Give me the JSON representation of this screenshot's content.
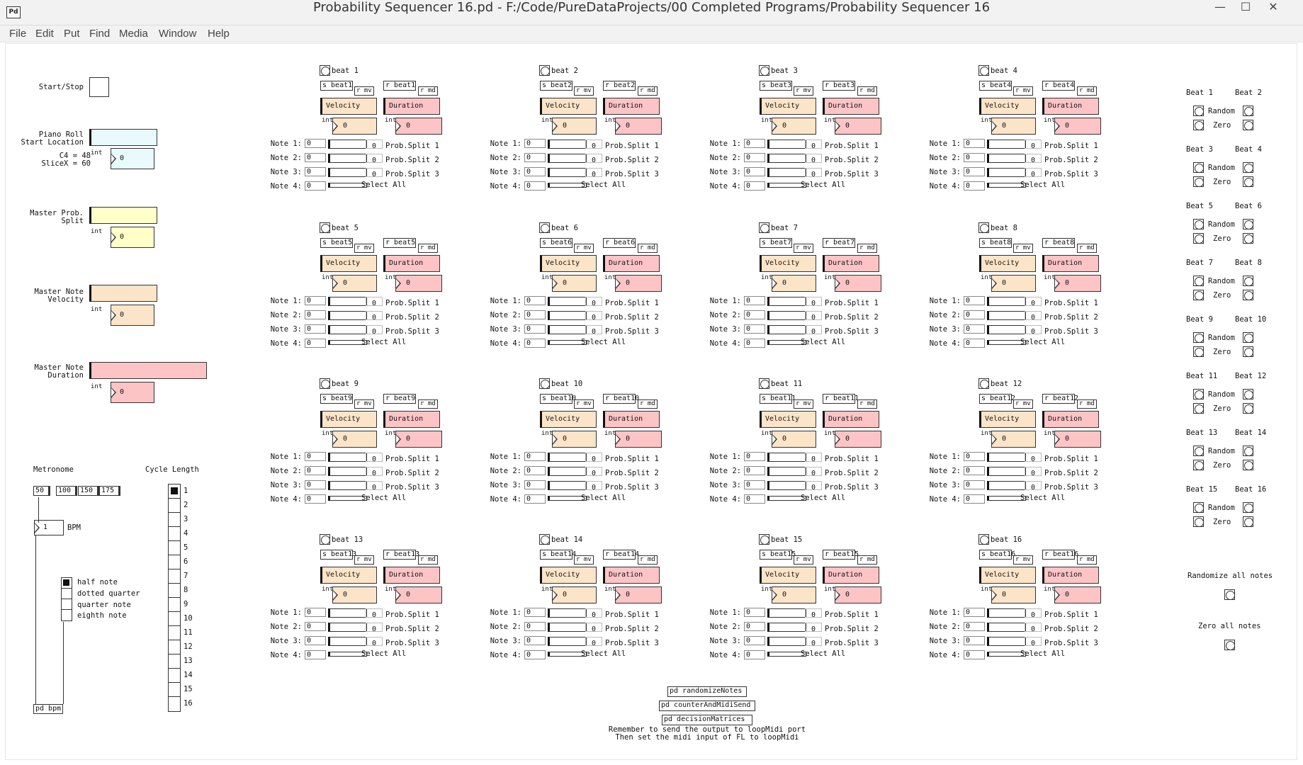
{
  "window": {
    "title": "Probability Sequencer 16.pd  - F:/Code/PureDataProjects/00 Completed Programs/Probability Sequencer 16",
    "minimize_glyph": "—",
    "maximize_glyph": "☐",
    "close_glyph": "✕"
  },
  "menu": [
    "File",
    "Edit",
    "Put",
    "Find",
    "Media",
    "Window",
    "Help"
  ],
  "left": {
    "start_stop": "Start/Stop",
    "piano_roll": "Piano Roll\nStart Location",
    "piano_note": "C4 = 48\nSliceX = 60",
    "master_prob": "Master Prob.\nSplit",
    "master_vel": "Master Note\nVelocity",
    "master_dur": "Master Note\nDuration",
    "int_label": "int",
    "num_value": "0"
  },
  "metronome": {
    "title": "Metronome",
    "presets": [
      "50",
      "100",
      "150",
      "175"
    ],
    "bpm_value": "1",
    "bpm_label": "BPM",
    "note_options": [
      "half note",
      "dotted quarter",
      "quarter note",
      "eighth note"
    ],
    "selected_note": 0,
    "pd_bpm": "pd bpm"
  },
  "cycle": {
    "title": "Cycle Length",
    "values": [
      "1",
      "2",
      "3",
      "4",
      "5",
      "6",
      "7",
      "8",
      "9",
      "10",
      "11",
      "12",
      "13",
      "14",
      "15",
      "16"
    ],
    "selected": 0
  },
  "beat_common": {
    "velocity": "Velocity",
    "duration": "Duration",
    "r_mv": "r mv",
    "r_md": "r md",
    "int": "int",
    "zero": "0",
    "note_labels": [
      "Note 1:",
      "Note 2:",
      "Note 3:",
      "Note 4:"
    ],
    "note_values": [
      "0",
      "0",
      "0",
      "0"
    ],
    "prob_labels": [
      "Prob.Split 1",
      "Prob.Split 2",
      "Prob.Split 3"
    ],
    "select_all": "Select All"
  },
  "beats": [
    {
      "title": "beat 1",
      "send": "s beat1",
      "recv": "r beat1"
    },
    {
      "title": "beat 2",
      "send": "s beat2",
      "recv": "r beat2"
    },
    {
      "title": "beat 3",
      "send": "s beat3",
      "recv": "r beat3"
    },
    {
      "title": "beat 4",
      "send": "s beat4",
      "recv": "r beat4"
    },
    {
      "title": "beat 5",
      "send": "s beat5",
      "recv": "r beat5"
    },
    {
      "title": "beat 6",
      "send": "s beat6",
      "recv": "r beat6"
    },
    {
      "title": "beat 7",
      "send": "s beat7",
      "recv": "r beat7"
    },
    {
      "title": "beat 8",
      "send": "s beat8",
      "recv": "r beat8"
    },
    {
      "title": "beat 9",
      "send": "s beat9",
      "recv": "r beat9"
    },
    {
      "title": "beat 10",
      "send": "s beat10",
      "recv": "r beat10"
    },
    {
      "title": "beat 11",
      "send": "s beat11",
      "recv": "r beat11"
    },
    {
      "title": "beat 12",
      "send": "s beat12",
      "recv": "r beat12"
    },
    {
      "title": "beat 13",
      "send": "s beat13",
      "recv": "r beat13"
    },
    {
      "title": "beat 14",
      "send": "s beat14",
      "recv": "r beat14"
    },
    {
      "title": "beat 15",
      "send": "s beat15",
      "recv": "r beat15"
    },
    {
      "title": "beat 16",
      "send": "s beat16",
      "recv": "r beat16"
    }
  ],
  "right": {
    "pairs": [
      [
        "Beat 1",
        "Beat 2"
      ],
      [
        "Beat 3",
        "Beat 4"
      ],
      [
        "Beat 5",
        "Beat 6"
      ],
      [
        "Beat 7",
        "Beat 8"
      ],
      [
        "Beat 9",
        "Beat 10"
      ],
      [
        "Beat 11",
        "Beat 12"
      ],
      [
        "Beat 13",
        "Beat 14"
      ],
      [
        "Beat 15",
        "Beat 16"
      ]
    ],
    "random": "Random",
    "zero": "Zero",
    "randomize_all": "Randomize all notes",
    "zero_all": "Zero all notes"
  },
  "bottom": {
    "subpatches": [
      "pd randomizeNotes",
      "pd counterAndMidiSend",
      "pd decisionMatrices"
    ],
    "note": "Remember to send the output to loopMidi port\nThen set the midi input of FL to loopMidi"
  },
  "colors": {
    "velocity": "#fce4c8",
    "duration": "#fdc4c6",
    "piano": "#e8fafc",
    "prob": "#ffffc8"
  }
}
